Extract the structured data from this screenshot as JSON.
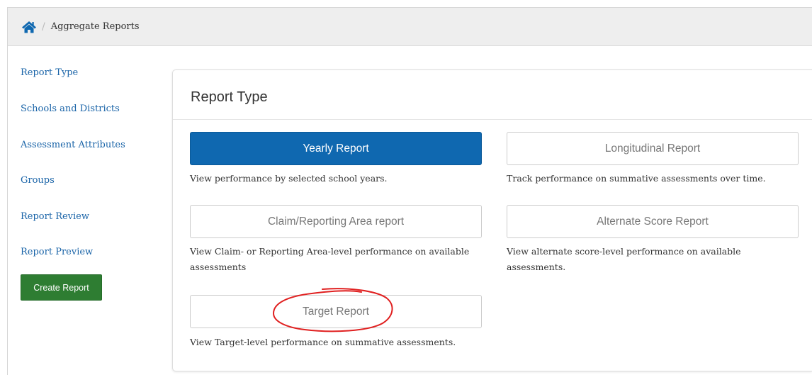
{
  "breadcrumb": {
    "home_icon": "home-icon",
    "separator": "/",
    "current": "Aggregate Reports"
  },
  "sidebar": {
    "items": [
      {
        "label": "Report Type"
      },
      {
        "label": "Schools and Districts"
      },
      {
        "label": "Assessment Attributes"
      },
      {
        "label": "Groups"
      },
      {
        "label": "Report Review"
      },
      {
        "label": "Report Preview"
      }
    ],
    "create_button": "Create Report"
  },
  "panel": {
    "title": "Report Type",
    "options": [
      {
        "label": "Yearly Report",
        "description": "View performance by selected school years.",
        "selected": true
      },
      {
        "label": "Longitudinal Report",
        "description": "Track performance on summative assessments over time.",
        "selected": false
      },
      {
        "label": "Claim/Reporting Area report",
        "description": "View Claim- or Reporting Area-level performance on available assessments",
        "selected": false
      },
      {
        "label": "Alternate Score Report",
        "description": "View alternate score-level performance on available assessments.",
        "selected": false
      },
      {
        "label": "Target Report",
        "description": "View Target-level performance on summative assessments.",
        "selected": false
      }
    ]
  },
  "colors": {
    "primary_blue": "#0f68b0",
    "link_blue": "#1a64a8",
    "create_green": "#2e7d32",
    "breadcrumb_bg": "#eeeeee",
    "annotation_red": "#e02020"
  }
}
